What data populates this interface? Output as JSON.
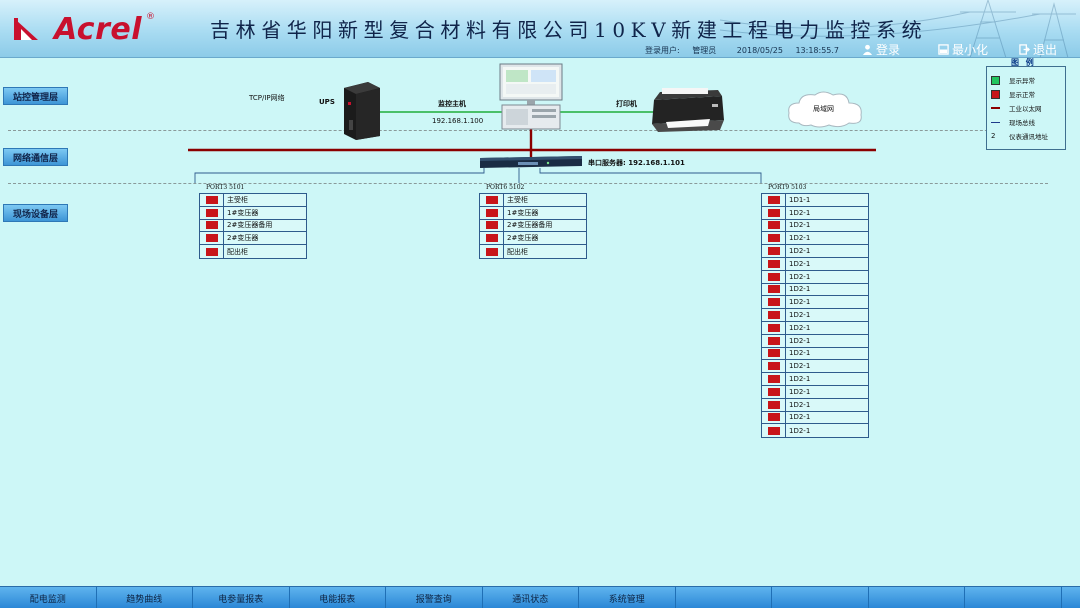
{
  "header": {
    "brand": "Acrel",
    "brand_reg": "®",
    "title": "吉林省华阳新型复合材料有限公司10KV新建工程电力监控系统",
    "user_label": "登录用户:",
    "user_name": "管理员",
    "date": "2018/05/25",
    "time": "13:18:55.7",
    "login_label": "登录",
    "minimize_label": "最小化",
    "exit_label": "退出"
  },
  "layers": {
    "station": "站控管理层",
    "network": "网络通信层",
    "field": "现场设备层"
  },
  "topology": {
    "tcp_label": "TCP/IP网络",
    "ups_label": "UPS",
    "host_label": "监控主机",
    "host_ip": "192.168.1.100",
    "printer_label": "打印机",
    "lan_label": "局域网",
    "serial_label": "串口服务器: 192.168.1.101"
  },
  "legend": {
    "title": "图 例",
    "items": [
      {
        "label": "显示异常",
        "color": "#22c55e",
        "kind": "square"
      },
      {
        "label": "显示正常",
        "color": "#c8151a",
        "kind": "square"
      },
      {
        "label": "工业以太网",
        "color": "#8b0000",
        "kind": "thick-line"
      },
      {
        "label": "现场总线",
        "color": "#1e3a8a",
        "kind": "thin-line"
      },
      {
        "label": "仪表通讯地址",
        "color": "#111111",
        "kind": "number",
        "symbol": "2"
      }
    ]
  },
  "ports": [
    {
      "name": "PORT3 5101",
      "rows": [
        "主受柜",
        "1#变压器",
        "2#变压器备用",
        "2#变压器",
        "配出柜"
      ]
    },
    {
      "name": "PORT6 5102",
      "rows": [
        "主受柜",
        "1#变压器",
        "2#变压器备用",
        "2#变压器",
        "配出柜"
      ]
    },
    {
      "name": "PORT9 5103",
      "rows": [
        "1D1-1",
        "1D2-1",
        "1D2-1",
        "1D2-1",
        "1D2-1",
        "1D2-1",
        "1D2-1",
        "1D2-1",
        "1D2-1",
        "1D2-1",
        "1D2-1",
        "1D2-1",
        "1D2-1",
        "1D2-1",
        "1D2-1",
        "1D2-1",
        "1D2-1",
        "1D2-1",
        "1D2-1"
      ]
    }
  ],
  "nav": [
    "配电监测",
    "趋势曲线",
    "电参量报表",
    "电能报表",
    "报警查询",
    "通讯状态",
    "系统管理",
    "",
    "",
    "",
    ""
  ],
  "colors": {
    "background": "#cdf7f7",
    "ethernet": "#8b0000",
    "fieldbus": "#1e3a8a",
    "green_line": "#1fae3a",
    "status_red": "#c8151a",
    "status_green": "#22c55e",
    "nav": "#2b87d6"
  }
}
